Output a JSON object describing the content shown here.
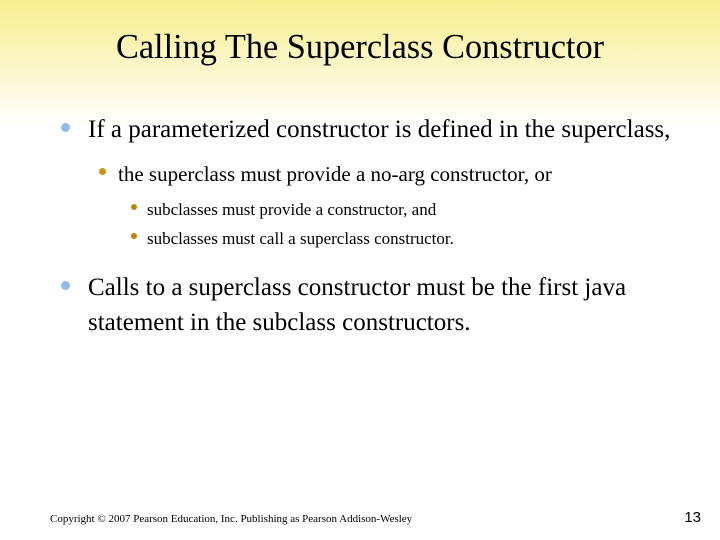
{
  "slide": {
    "title": "Calling The Superclass Constructor",
    "page_number": "13",
    "copyright": "Copyright © 2007 Pearson Education, Inc. Publishing as Pearson Addison-Wesley",
    "colors": {
      "background_top": "#F7EE92",
      "background_bottom": "#FFFFFF",
      "bullet_level1": "#92BCE8",
      "bullet_level2": "#C8960C",
      "bullet_level3": "#B8860B",
      "text": "#000000"
    },
    "bullets": [
      {
        "level": 1,
        "text": "If a parameterized constructor is defined in the superclass,"
      },
      {
        "level": 2,
        "text": "the superclass must provide a no-arg constructor, or"
      },
      {
        "level": 3,
        "text": "subclasses must provide a constructor, and"
      },
      {
        "level": 3,
        "text": "subclasses must call a superclass constructor."
      },
      {
        "level": 1,
        "text": "Calls to a superclass constructor must be the first java statement in the subclass constructors."
      }
    ]
  }
}
